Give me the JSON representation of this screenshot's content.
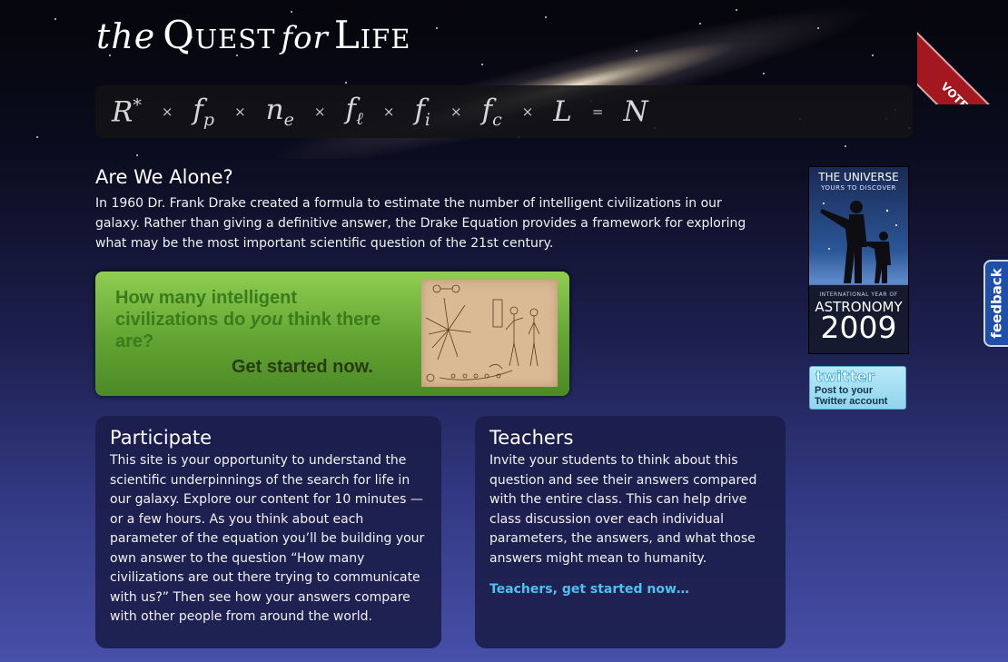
{
  "header": {
    "logo": {
      "the": "the",
      "quest": "Quest",
      "for": "for",
      "life": "Life"
    },
    "equation": [
      {
        "base": "R",
        "sup": "*",
        "sub": ""
      },
      {
        "op": "×"
      },
      {
        "base": "f",
        "sub": "p"
      },
      {
        "op": "×"
      },
      {
        "base": "n",
        "sub": "e"
      },
      {
        "op": "×"
      },
      {
        "base": "f",
        "sub": "ℓ"
      },
      {
        "op": "×"
      },
      {
        "base": "f",
        "sub": "i"
      },
      {
        "op": "×"
      },
      {
        "base": "f",
        "sub": "c"
      },
      {
        "op": "×"
      },
      {
        "base": "L",
        "sub": ""
      },
      {
        "op": "="
      },
      {
        "base": "N",
        "sub": ""
      }
    ],
    "vote_label": "VOTE!"
  },
  "intro": {
    "heading": "Are We Alone?",
    "text": "In 1960 Dr. Frank Drake created a formula to estimate the number of intelligent civilizations in our galaxy. Rather than giving a definitive answer, the Drake Equation provides a framework for exploring what may be the most important scientific question of the 21st century."
  },
  "cta": {
    "question_part1": "How many intelligent civilizations do ",
    "question_em": "you",
    "question_part2": " think there are?",
    "action": "Get started now."
  },
  "participate": {
    "heading": "Participate",
    "text": "This site is your opportunity to understand the scientific underpinnings of the search for life in our galaxy. Explore our content for 10 minutes — or a few hours. As you think about each parameter of the equation you’ll be building your own answer to the question “How many civilizations are out there trying to communicate with us?” Then see how your answers compare with other people from around the world."
  },
  "teachers": {
    "heading": "Teachers",
    "text": "Invite your students to think about this question and see their answers compared with the entire class. This can help drive class discussion over each individual parameters, the answers, and what those answers might mean to humanity.",
    "link": "Teachers, get started now…"
  },
  "sidebar": {
    "iya": {
      "line1": "THE UNIVERSE",
      "line2": "YOURS TO DISCOVER",
      "line3": "INTERNATIONAL YEAR OF",
      "line4": "ASTRONOMY",
      "year": "2009"
    },
    "twitter": {
      "logo": "twitter",
      "line1": "Post to your",
      "line2": "Twitter account"
    }
  },
  "feedback_label": "feedback",
  "colors": {
    "cta_green": "#63a331",
    "link_blue": "#4fc0ef",
    "card_bg": "#1b1e4b",
    "vote_red": "#a3171e"
  }
}
